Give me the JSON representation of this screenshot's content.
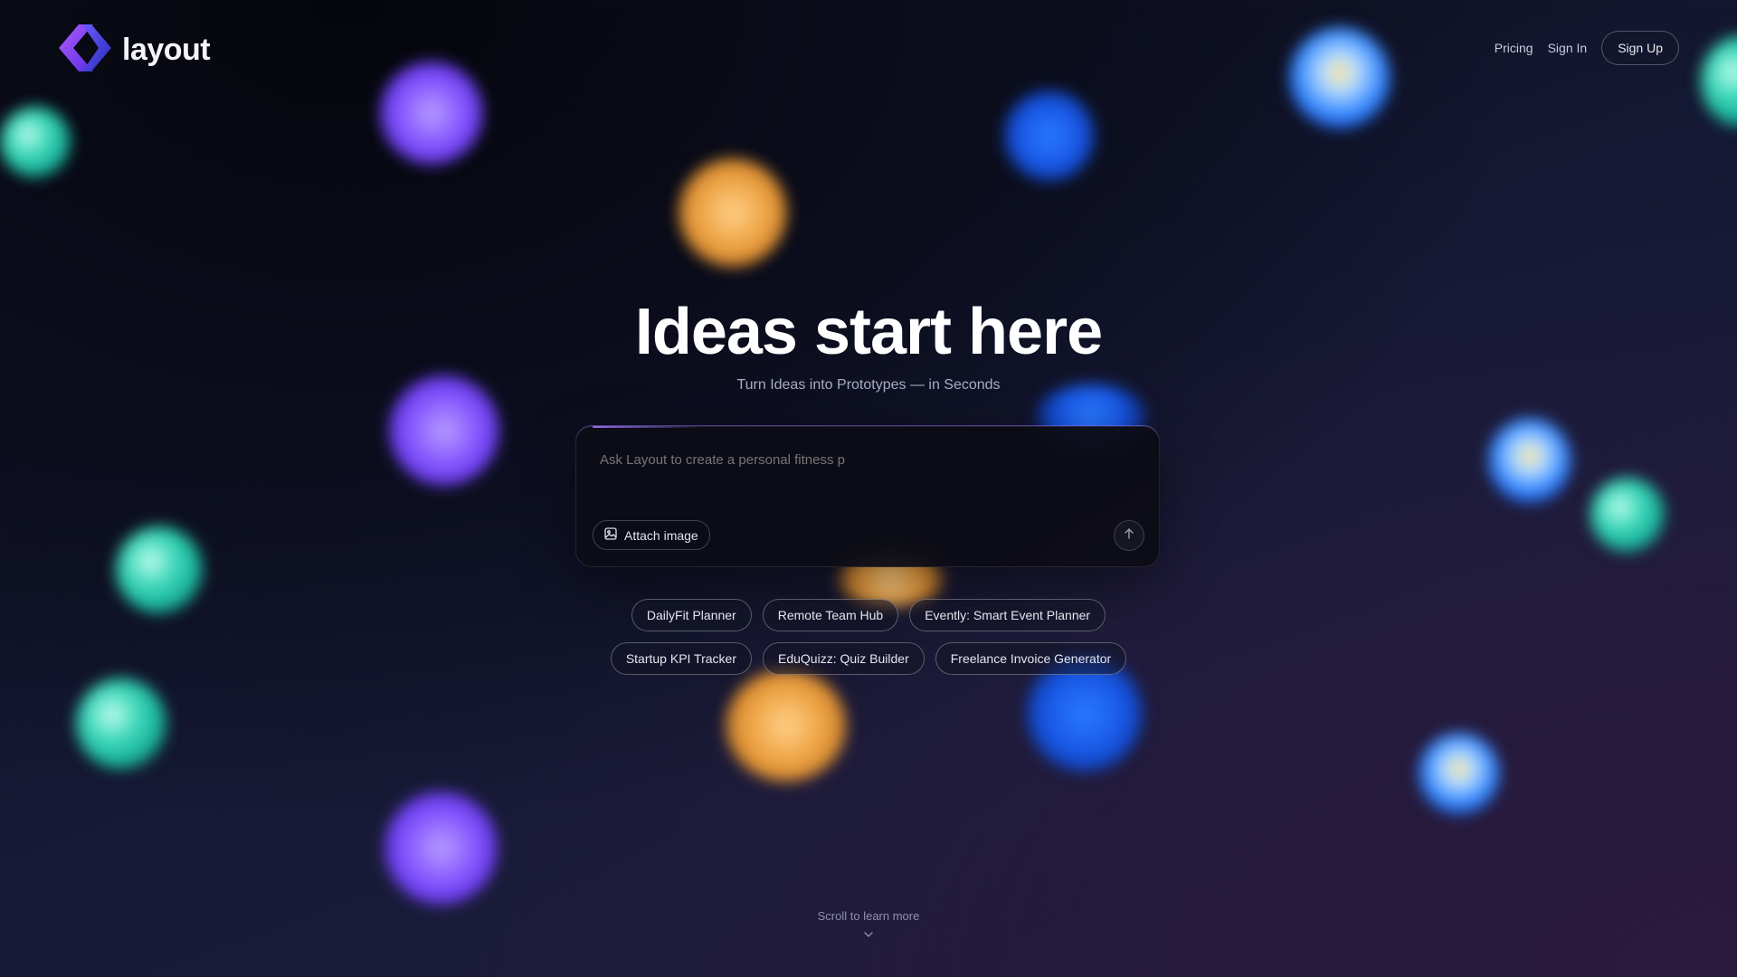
{
  "brand": {
    "name": "layout",
    "logo_icon": "layout-logo-icon"
  },
  "nav": {
    "pricing": "Pricing",
    "sign_in": "Sign In",
    "sign_up": "Sign Up"
  },
  "hero": {
    "title": "Ideas start here",
    "subtitle": "Turn Ideas into Prototypes — in Seconds"
  },
  "prompt": {
    "placeholder": "Ask Layout to create a personal fitness p",
    "attach_label": "Attach image",
    "attach_icon": "image-icon",
    "send_icon": "arrow-up-icon"
  },
  "suggestions": {
    "row1": [
      "DailyFit Planner",
      "Remote Team Hub",
      "Evently: Smart Event Planner"
    ],
    "row2": [
      "Startup KPI Tracker",
      "EduQuizz: Quiz Builder",
      "Freelance Invoice Generator"
    ]
  },
  "footer": {
    "scroll_hint": "Scroll to learn more",
    "scroll_icon": "chevron-down-icon"
  },
  "colors": {
    "background": "#141833",
    "accent_purple": "#8a5cff",
    "accent_blue": "#1a5ae8",
    "accent_orange": "#f0a84a",
    "accent_teal": "#18b09a"
  }
}
